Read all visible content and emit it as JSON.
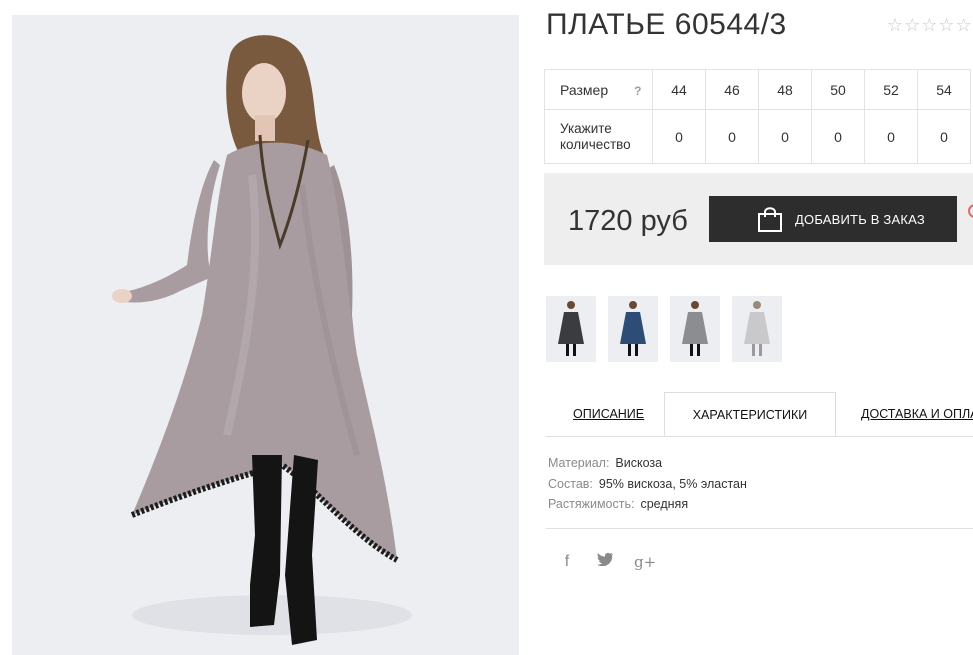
{
  "product": {
    "title": "ПЛАТЬЕ 60544/3",
    "rating_stars": "☆☆☆☆☆",
    "price": "1720 руб",
    "add_to_cart_label": "ДОБАВИТЬ В ЗАКАЗ"
  },
  "sizes": {
    "size_header": "Размер",
    "help_mark": "?",
    "qty_header": "Укажите\nколичество",
    "items": [
      {
        "size": "44",
        "qty": "0"
      },
      {
        "size": "46",
        "qty": "0"
      },
      {
        "size": "48",
        "qty": "0"
      },
      {
        "size": "50",
        "qty": "0"
      },
      {
        "size": "52",
        "qty": "0"
      },
      {
        "size": "54",
        "qty": "0"
      }
    ]
  },
  "thumbnails": [
    {
      "color": "#3a3c3f"
    },
    {
      "color": "#2d4d77"
    },
    {
      "color": "#8b8d90"
    },
    {
      "color": "#c9c9cb"
    }
  ],
  "tabs": [
    {
      "label": "ОПИСАНИЕ"
    },
    {
      "label": "ХАРАКТЕРИСТИКИ"
    },
    {
      "label": "ДОСТАВКА И ОПЛАТА"
    }
  ],
  "specs": [
    {
      "label": "Материал:",
      "value": "Вискоза"
    },
    {
      "label": "Состав:",
      "value": "95% вискоза, 5% эластан"
    },
    {
      "label": "Растяжимость:",
      "value": "средняя"
    }
  ],
  "social": {
    "facebook": "f",
    "twitter": "🐦",
    "googleplus": "g+"
  },
  "colors": {
    "dress": "#a89ca0",
    "button": "#2d2d2d",
    "price_box": "#eeeeee"
  }
}
